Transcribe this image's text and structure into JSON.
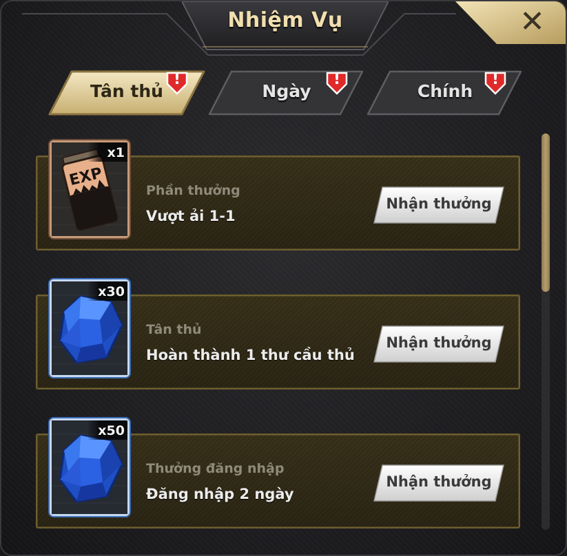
{
  "window": {
    "title": "Nhiệm Vụ",
    "close_label": "✕"
  },
  "tabs": [
    {
      "label": "Tân thủ",
      "active": true,
      "alert": "!"
    },
    {
      "label": "Ngày",
      "active": false,
      "alert": "!"
    },
    {
      "label": "Chính",
      "active": false,
      "alert": "!"
    }
  ],
  "quests": [
    {
      "label": "Phần thưởng",
      "description": "Vượt ải 1-1",
      "reward_icon": "exp-potion-icon",
      "reward_text": "EXP",
      "quantity": "x1",
      "button": "Nhận thưởng"
    },
    {
      "label": "Tân thủ",
      "description": "Hoàn thành 1 thư cầu thủ",
      "reward_icon": "blue-gem-icon",
      "quantity": "x30",
      "button": "Nhận thưởng"
    },
    {
      "label": "Thưởng đăng nhập",
      "description": "Đăng nhập 2 ngày",
      "reward_icon": "blue-gem-icon",
      "quantity": "x50",
      "button": "Nhận thưởng"
    }
  ],
  "scrollbar": {
    "position": 0.0,
    "visible_fraction": 0.4
  },
  "colors": {
    "accent_gold": "#d9c48a",
    "row_border": "#6e5f2e",
    "alert_red": "#e22b2b",
    "gem_blue": "#2d6fe0"
  }
}
